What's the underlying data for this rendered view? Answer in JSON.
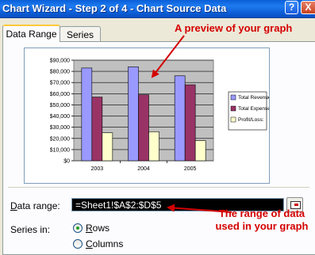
{
  "window": {
    "title": "Chart Wizard - Step 2 of 4 - Chart Source Data",
    "help_label": "?",
    "close_label": "X"
  },
  "tabs": [
    {
      "label": "Data Range",
      "active": true
    },
    {
      "label": "Series",
      "active": false
    }
  ],
  "annotations": {
    "preview": "A preview of your graph",
    "range_line1": "The range of data",
    "range_line2": "used in your graph"
  },
  "form": {
    "data_range_label": "Data range:",
    "data_range_value": "=Sheet1!$A$2:$D$5",
    "series_in_label": "Series in:",
    "series_options": [
      {
        "label": "Rows",
        "selected": true
      },
      {
        "label": "Columns",
        "selected": false
      }
    ]
  },
  "chart_data": {
    "type": "bar",
    "categories": [
      "2003",
      "2004",
      "2005"
    ],
    "series": [
      {
        "name": "Total Revenues",
        "values": [
          83000,
          84000,
          76000
        ],
        "color": "#9999FF"
      },
      {
        "name": "Total Expenses",
        "values": [
          57000,
          59000,
          68000
        ],
        "color": "#993366"
      },
      {
        "name": "Profit/Loss:",
        "values": [
          25000,
          26000,
          18000
        ],
        "color": "#FFFFCC"
      }
    ],
    "yticks": [
      "$0",
      "$10,000",
      "$20,000",
      "$30,000",
      "$40,000",
      "$50,000",
      "$60,000",
      "$70,000",
      "$80,000",
      "$90,000"
    ],
    "ylim": [
      0,
      90000
    ],
    "plot_bg": "#C0C0C0",
    "legend": "right"
  }
}
